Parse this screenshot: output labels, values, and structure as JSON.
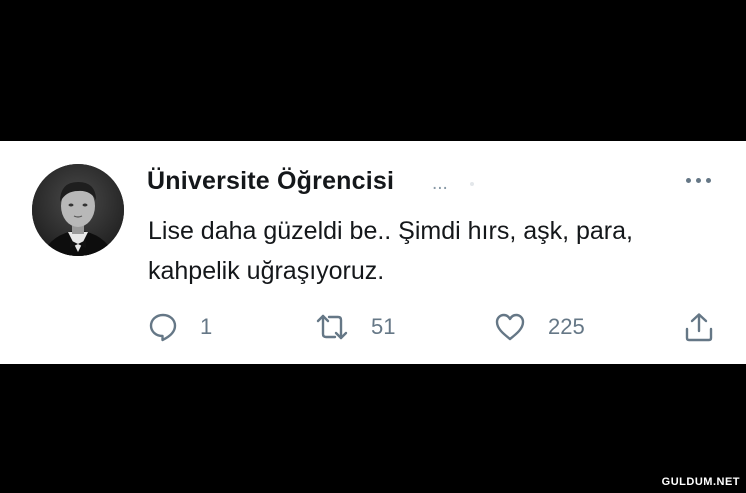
{
  "tweet": {
    "author_name": "Üniversite Öğrencisi",
    "handle_truncated": "...",
    "text": "Lise daha güzeldi be.. Şimdi hırs, aşk, para, kahpelik uğraşıyoruz.",
    "actions": {
      "reply_count": "1",
      "retweet_count": "51",
      "like_count": "225"
    }
  },
  "icons": {
    "reply": "comment-bubble-icon",
    "retweet": "retweet-arrows-icon",
    "like": "heart-icon",
    "share": "share-upload-icon",
    "more": "more-dots-icon"
  },
  "colors": {
    "text": "#14171a",
    "secondary": "#657786",
    "background": "#ffffff",
    "outer": "#000000"
  },
  "watermark": "GULDUM.NET"
}
